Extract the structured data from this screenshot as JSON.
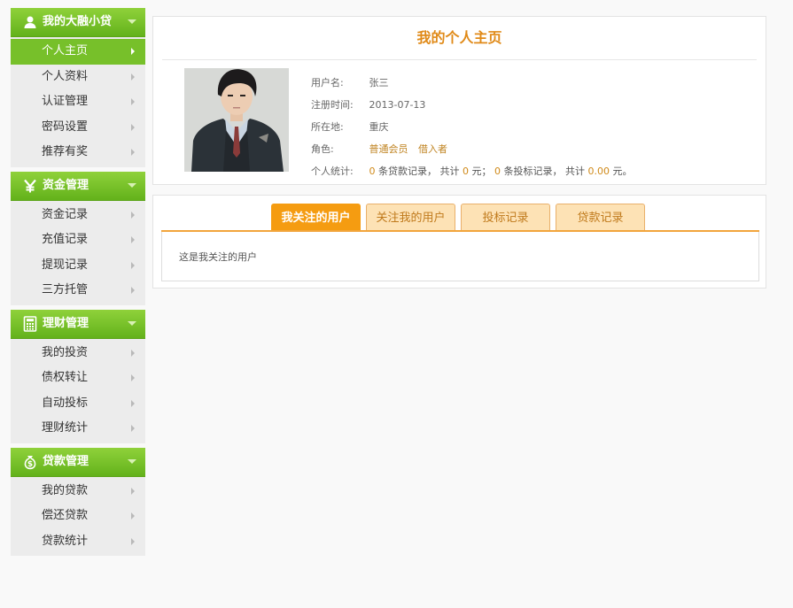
{
  "sidebar": {
    "groups": [
      {
        "title": "我的大融小贷",
        "icon": "user-icon",
        "items": [
          {
            "label": "个人主页",
            "active": true
          },
          {
            "label": "个人资料"
          },
          {
            "label": "认证管理"
          },
          {
            "label": "密码设置"
          },
          {
            "label": "推荐有奖"
          }
        ]
      },
      {
        "title": "资金管理",
        "icon": "yen-icon",
        "items": [
          {
            "label": "资金记录"
          },
          {
            "label": "充值记录"
          },
          {
            "label": "提现记录"
          },
          {
            "label": "三方托管"
          }
        ]
      },
      {
        "title": "理财管理",
        "icon": "calculator-icon",
        "items": [
          {
            "label": "我的投资"
          },
          {
            "label": "债权转让"
          },
          {
            "label": "自动投标"
          },
          {
            "label": "理财统计"
          }
        ]
      },
      {
        "title": "贷款管理",
        "icon": "money-bag-icon",
        "items": [
          {
            "label": "我的贷款"
          },
          {
            "label": "偿还贷款"
          },
          {
            "label": "贷款统计"
          }
        ]
      }
    ]
  },
  "profile": {
    "title": "我的个人主页",
    "username_label": "用户名:",
    "username": "张三",
    "register_label": "注册时间:",
    "register_date": "2013-07-13",
    "location_label": "所在地:",
    "location": "重庆",
    "role_label": "角色:",
    "role_1": "普通会员",
    "role_2": "借入者",
    "stats_label": "个人统计:",
    "loan_count": "0",
    "loan_text": "条贷款记录，",
    "total_text_1": "共计",
    "loan_total": "0",
    "unit_1": "元；",
    "bid_count": "0",
    "bid_text": "条投标记录，",
    "total_text_2": "共计",
    "bid_total": "0.00",
    "unit_2": "元。"
  },
  "tabs": {
    "items": [
      "我关注的用户",
      "关注我的用户",
      "投标记录",
      "贷款记录"
    ],
    "content": "这是我关注的用户"
  },
  "colors": {
    "green": "#77c02a",
    "orange": "#f59c11",
    "gold": "#d08a1a"
  }
}
